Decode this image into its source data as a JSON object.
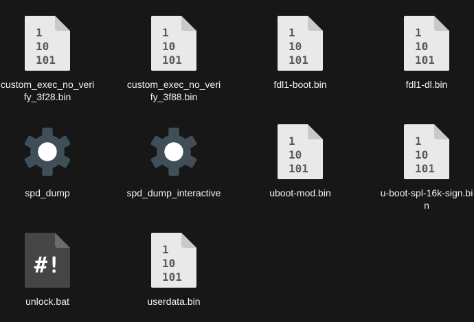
{
  "window": {
    "view": "file-grid"
  },
  "colors": {
    "background": "#171717",
    "binary_page": "#e9e9e9",
    "binary_fold": "#c9c9c9",
    "binary_text": "#5a5a5a",
    "gear": "#3f4e57",
    "script_page": "#454545",
    "script_fold": "#6b6b6b",
    "label_text": "#f2f2f2"
  },
  "files": [
    {
      "label": "custom_exec_no_verify_3f28.bin",
      "icon": "binary-file-icon"
    },
    {
      "label": "custom_exec_no_verify_3f88.bin",
      "icon": "binary-file-icon"
    },
    {
      "label": "fdl1-boot.bin",
      "icon": "binary-file-icon"
    },
    {
      "label": "fdl1-dl.bin",
      "icon": "binary-file-icon"
    },
    {
      "label": "spd_dump",
      "icon": "executable-gear-icon"
    },
    {
      "label": "spd_dump_interactive",
      "icon": "executable-gear-icon"
    },
    {
      "label": "uboot-mod.bin",
      "icon": "binary-file-icon"
    },
    {
      "label": "u-boot-spl-16k-sign.bin",
      "icon": "binary-file-icon"
    },
    {
      "label": "unlock.bat",
      "icon": "script-file-icon"
    },
    {
      "label": "userdata.bin",
      "icon": "binary-file-icon"
    }
  ],
  "binary_glyph": {
    "line1": "1",
    "line2": "10",
    "line3": "101"
  },
  "script_glyph": "#!"
}
